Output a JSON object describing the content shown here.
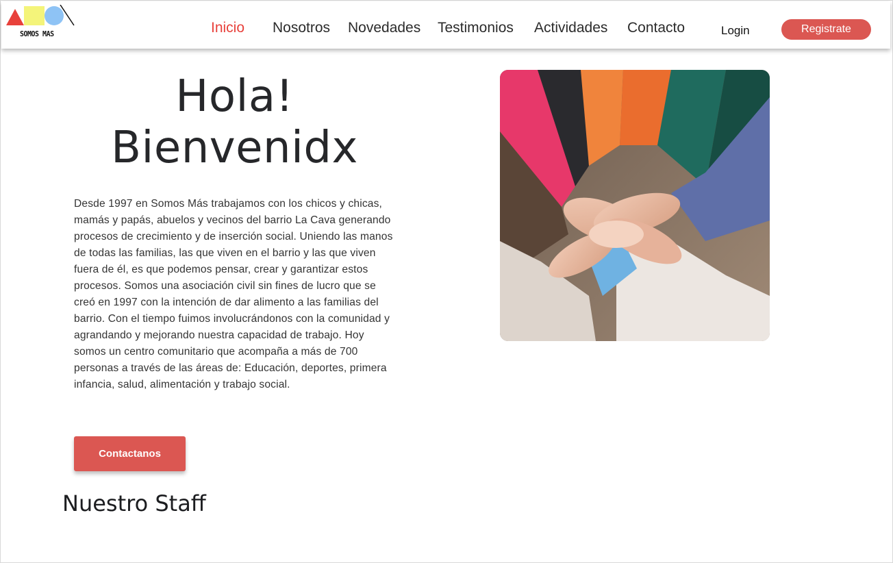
{
  "header": {
    "logo_text": "SOMOS MAS",
    "nav": [
      {
        "label": "Inicio",
        "active": true
      },
      {
        "label": "Nosotros",
        "active": false
      },
      {
        "label": "Novedades",
        "active": false
      },
      {
        "label": "Testimonios",
        "active": false
      },
      {
        "label": "Actividades",
        "active": false
      },
      {
        "label": "Contacto",
        "active": false
      }
    ],
    "login_label": "Login",
    "register_label": "Registrate"
  },
  "hero": {
    "title_line1": "Hola!",
    "title_line2": "Bienvenidx",
    "description": "Desde 1997 en Somos Más trabajamos con los chicos y chicas, mamás y papás, abuelos y vecinos del barrio La Cava generando procesos de crecimiento y de inserción social. Uniendo las manos de todas las familias, las que viven en el barrio y las que viven fuera de él, es que podemos pensar, crear y garantizar estos procesos. Somos una asociación civil sin fines de lucro que se creó en 1997 con la intención de dar alimento a las familias del barrio. Con el tiempo fuimos involucrándonos con la comunidad y agrandando y mejorando nuestra capacidad de trabajo. Hoy somos un centro comunitario que acompaña a más de 700 personas a través de las áreas de: Educación, deportes, primera infancia, salud, alimentación y trabajo social.",
    "cta_label": "Contactanos"
  },
  "staff": {
    "title": "Nuestro Staff"
  },
  "colors": {
    "accent": "#db5752",
    "active_nav": "#e8413b",
    "logo_triangle": "#e8413b",
    "logo_square": "#f4f47a",
    "logo_circle": "#8ec3f5"
  }
}
